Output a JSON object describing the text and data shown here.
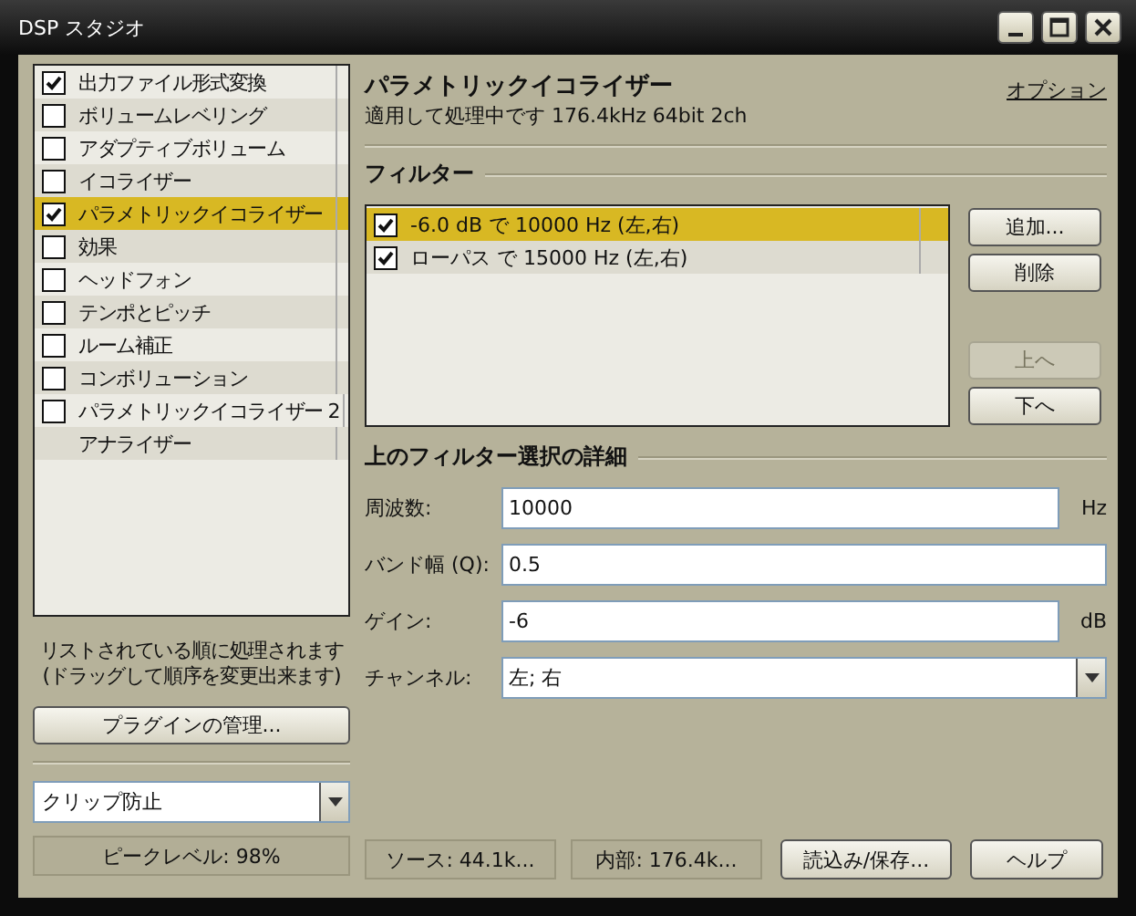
{
  "window": {
    "title": "DSP スタジオ"
  },
  "plugins": [
    {
      "kind": "check",
      "label": "出力ファイル形式変換",
      "checked": true,
      "selected": false
    },
    {
      "kind": "check",
      "label": "ボリュームレベリング",
      "checked": false,
      "selected": false
    },
    {
      "kind": "check",
      "label": "アダプティブボリューム",
      "checked": false,
      "selected": false
    },
    {
      "kind": "check",
      "label": "イコライザー",
      "checked": false,
      "selected": false
    },
    {
      "kind": "check",
      "label": "パラメトリックイコライザー",
      "checked": true,
      "selected": true
    },
    {
      "kind": "check",
      "label": "効果",
      "checked": false,
      "selected": false
    },
    {
      "kind": "check",
      "label": "ヘッドフォン",
      "checked": false,
      "selected": false
    },
    {
      "kind": "check",
      "label": "テンポとピッチ",
      "checked": false,
      "selected": false
    },
    {
      "kind": "check",
      "label": "ルーム補正",
      "checked": false,
      "selected": false
    },
    {
      "kind": "check",
      "label": "コンボリューション",
      "checked": false,
      "selected": false
    },
    {
      "kind": "check",
      "label": "パラメトリックイコライザー 2",
      "checked": false,
      "selected": false
    },
    {
      "kind": "plain",
      "label": "アナライザー",
      "selected": false
    }
  ],
  "order_note": [
    "リストされている順に処理されます",
    "(ドラッグして順序を変更出来ます)"
  ],
  "manage_button": "プラグインの管理...",
  "clip_select": {
    "value": "クリップ防止"
  },
  "peak": "ピークレベル: 98%",
  "header": {
    "title": "パラメトリックイコライザー",
    "subtitle": "適用して処理中です 176.4kHz 64bit 2ch",
    "options_link": "オプション"
  },
  "filters_label": "フィルター",
  "filters": [
    {
      "label": "-6.0 dB で 10000 Hz (左,右)",
      "checked": true,
      "selected": true
    },
    {
      "label": "ローパス で 15000 Hz (左,右)",
      "checked": true,
      "selected": false
    }
  ],
  "filter_buttons": [
    {
      "label": "追加...",
      "disabled": false
    },
    {
      "label": "削除",
      "disabled": false
    },
    {
      "label": "上へ",
      "disabled": true
    },
    {
      "label": "下へ",
      "disabled": false
    }
  ],
  "details_label": "上のフィルター選択の詳細",
  "fields": [
    {
      "kind": "text",
      "label": "周波数:",
      "value": "10000",
      "unit": "Hz"
    },
    {
      "kind": "text",
      "label": "バンド幅 (Q):",
      "value": "0.5"
    },
    {
      "kind": "text",
      "label": "ゲイン:",
      "value": "-6",
      "unit": "dB"
    },
    {
      "kind": "select",
      "label": "チャンネル:",
      "value": "左; 右"
    }
  ],
  "status": {
    "source": "ソース: 44.1k...",
    "internal": "内部: 176.4k..."
  },
  "bottom_buttons": [
    "読込み/保存...",
    "ヘルプ"
  ]
}
